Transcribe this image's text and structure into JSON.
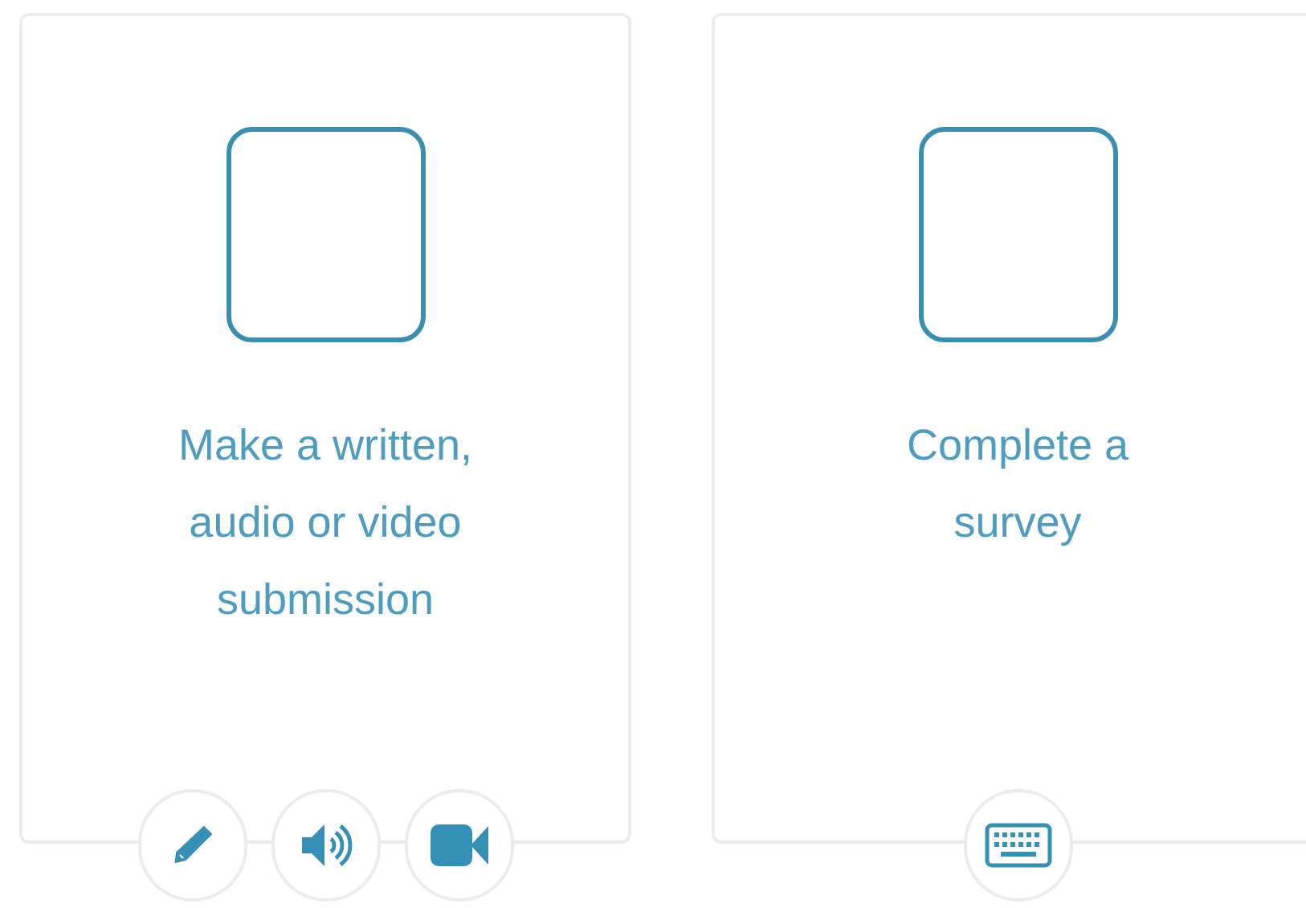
{
  "cards": [
    {
      "text": "Make a written,\naudio or video\nsubmission",
      "tools": [
        {
          "kind": "pencil"
        },
        {
          "kind": "speaker"
        },
        {
          "kind": "video"
        }
      ]
    },
    {
      "text": "Complete a\nsurvey",
      "tools": [
        {
          "kind": "keyboard"
        }
      ]
    }
  ]
}
